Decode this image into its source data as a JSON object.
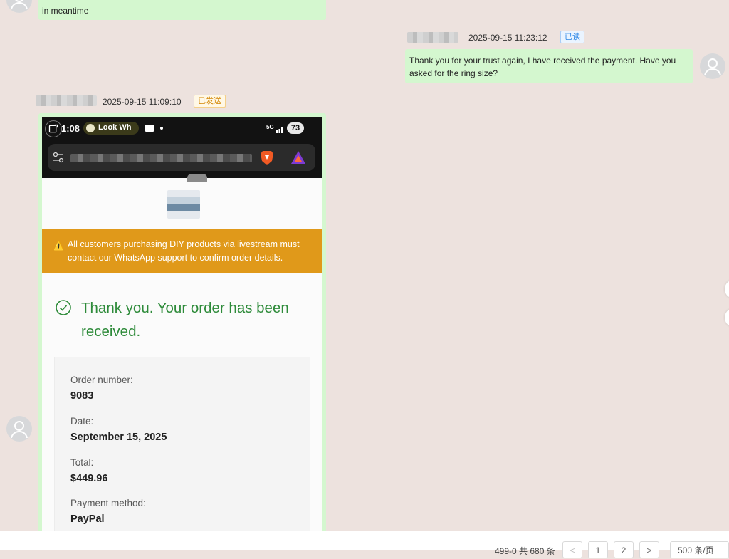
{
  "top_message": {
    "text_partial": "in meantime"
  },
  "outgoing_message": {
    "timestamp": "2025-09-15 11:23:12",
    "status": "已读",
    "text": "Thank you for your trust again, I have received the payment. Have you asked for the ring size?"
  },
  "incoming_message": {
    "timestamp": "2025-09-15 11:09:10",
    "status": "已发送"
  },
  "screenshot": {
    "clock": "1:08",
    "music_pill": "Look Wh",
    "battery": "73",
    "signal": "5G",
    "warning": "All customers purchasing DIY products via livestream must contact our WhatsApp support to confirm order details.",
    "thank_you": "Thank you. Your order has been received.",
    "order": [
      {
        "label": "Order number:",
        "value": "9083"
      },
      {
        "label": "Date:",
        "value": "September 15, 2025"
      },
      {
        "label": "Total:",
        "value": "$449.96"
      },
      {
        "label": "Payment method:",
        "value": "PayPal"
      }
    ]
  },
  "footer": {
    "range_text": "499-0 共 680 条",
    "prev": "<",
    "page1": "1",
    "page2": "2",
    "next": ">",
    "page_size": "500 条/页"
  },
  "colors": {
    "bubble": "#d4f7cf",
    "background": "#ede2de",
    "warning": "#e0991a",
    "success": "#2e8b3a"
  }
}
